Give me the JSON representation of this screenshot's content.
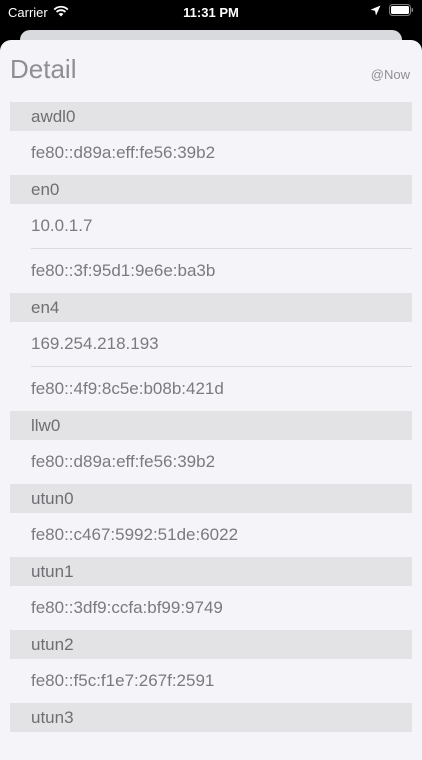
{
  "status_bar": {
    "carrier": "Carrier",
    "time": "11:31 PM"
  },
  "header": {
    "title": "Detail",
    "timestamp": "@Now"
  },
  "interfaces": [
    {
      "name": "awdl0",
      "addresses": [
        "fe80::d89a:eff:fe56:39b2"
      ]
    },
    {
      "name": "en0",
      "addresses": [
        "10.0.1.7",
        "fe80::3f:95d1:9e6e:ba3b"
      ]
    },
    {
      "name": "en4",
      "addresses": [
        "169.254.218.193",
        "fe80::4f9:8c5e:b08b:421d"
      ]
    },
    {
      "name": "llw0",
      "addresses": [
        "fe80::d89a:eff:fe56:39b2"
      ]
    },
    {
      "name": "utun0",
      "addresses": [
        "fe80::c467:5992:51de:6022"
      ]
    },
    {
      "name": "utun1",
      "addresses": [
        "fe80::3df9:ccfa:bf99:9749"
      ]
    },
    {
      "name": "utun2",
      "addresses": [
        "fe80::f5c:f1e7:267f:2591"
      ]
    },
    {
      "name": "utun3",
      "addresses": []
    }
  ]
}
